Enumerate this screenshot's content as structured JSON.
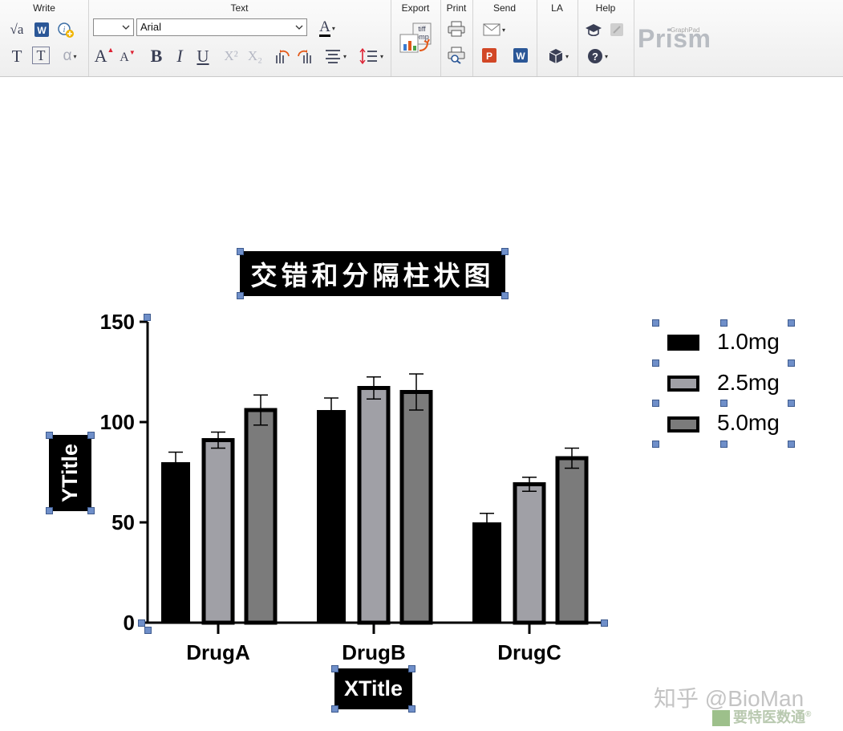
{
  "toolbar": {
    "groups": {
      "write": "Write",
      "text": "Text",
      "export": "Export",
      "print": "Print",
      "send": "Send",
      "la": "LA",
      "help": "Help"
    },
    "font_size_value": "",
    "font_name_value": "Arial",
    "export_icon_text_1": "tiff",
    "export_icon_text_2": "bmp",
    "brand": "Prism",
    "brand_small": "GraphPad",
    "superscript_label": "X²",
    "subscript_label": "X₂"
  },
  "chart_data": {
    "type": "bar",
    "title": "交错和分隔柱状图",
    "xlabel": "XTitle",
    "ylabel": "YTitle",
    "categories": [
      "DrugA",
      "DrugB",
      "DrugC"
    ],
    "ylim": [
      0,
      150
    ],
    "yticks": [
      0,
      50,
      100,
      150
    ],
    "series": [
      {
        "name": "1.0mg",
        "color": "#000000",
        "values": [
          80,
          106,
          50
        ],
        "errors": [
          5,
          6,
          4.5
        ]
      },
      {
        "name": "2.5mg",
        "color": "#a0a0a6",
        "values": [
          91,
          117,
          69
        ],
        "errors": [
          4,
          5.5,
          3.5
        ]
      },
      {
        "name": "5.0mg",
        "color": "#7b7b7b",
        "values": [
          106,
          115,
          82
        ],
        "errors": [
          7.5,
          9,
          5
        ]
      }
    ],
    "legend_position": "right"
  },
  "watermark": {
    "text": "知乎 @BioMan",
    "sub": "要特医数通",
    "reg": "®"
  }
}
